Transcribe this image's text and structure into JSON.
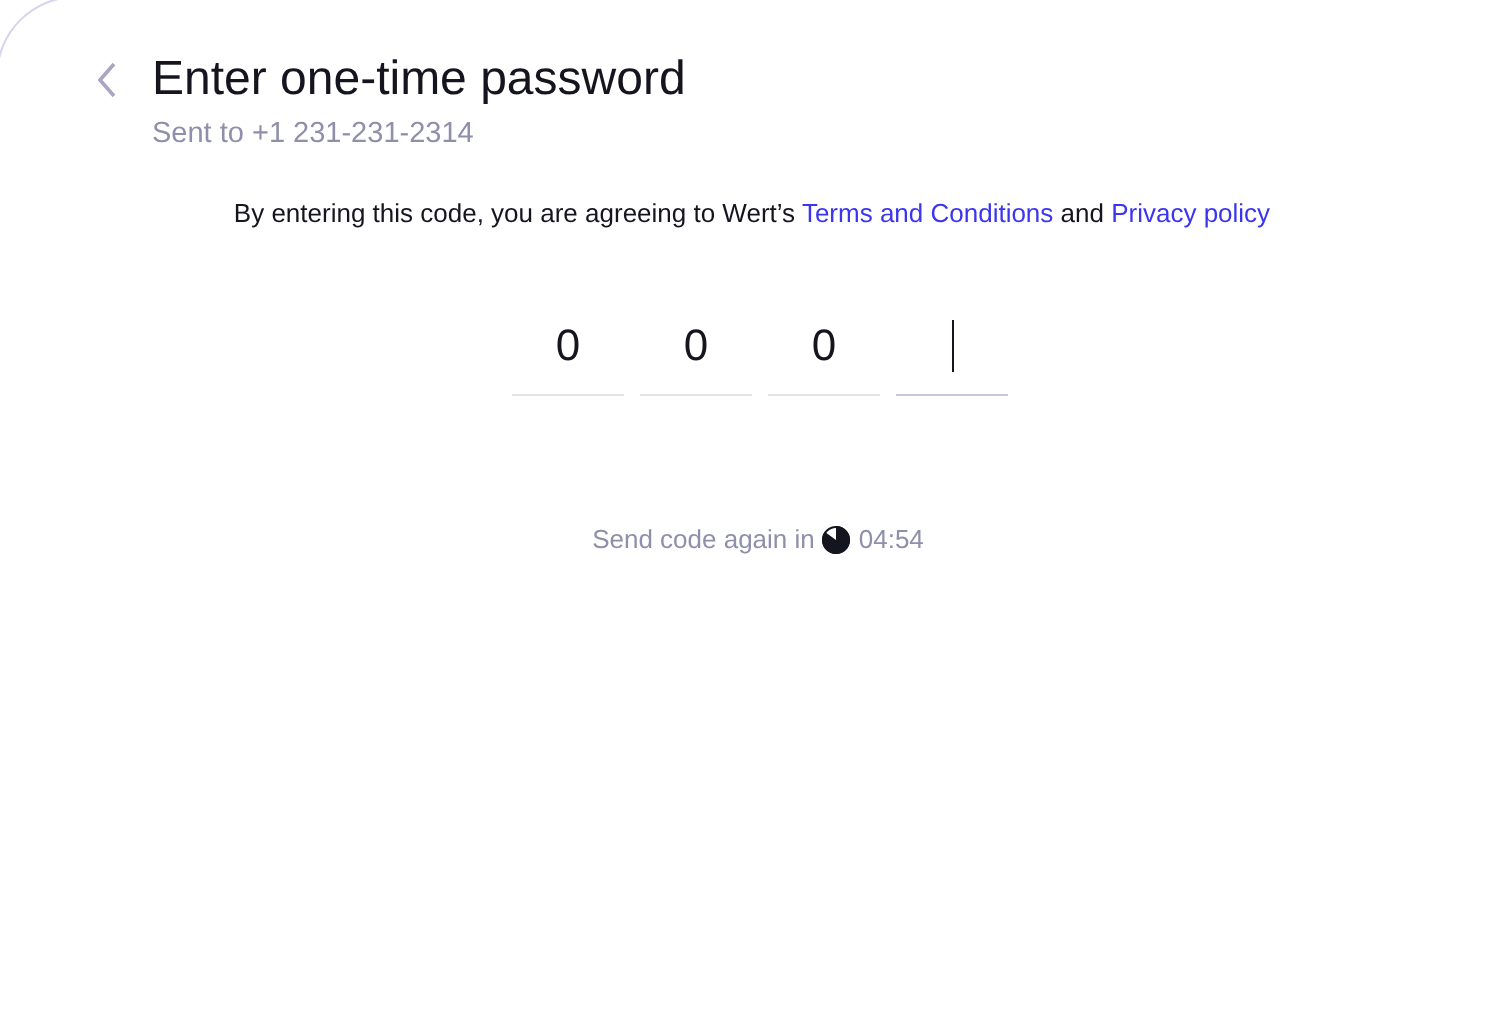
{
  "header": {
    "title": "Enter one-time password",
    "subtitle": "Sent to +1 231-231-2314"
  },
  "agreement": {
    "text": "By entering this code, you are agreeing to Wert’s",
    "terms_link": "Terms and Conditions",
    "joiner": "and",
    "privacy_link": "Privacy policy"
  },
  "code_fields": [
    {
      "value": "0",
      "focused": false
    },
    {
      "value": "0",
      "focused": false
    },
    {
      "value": "0",
      "focused": false
    },
    {
      "focused": true
    }
  ],
  "resend": {
    "text": "Send code again in",
    "time": "04:54"
  }
}
